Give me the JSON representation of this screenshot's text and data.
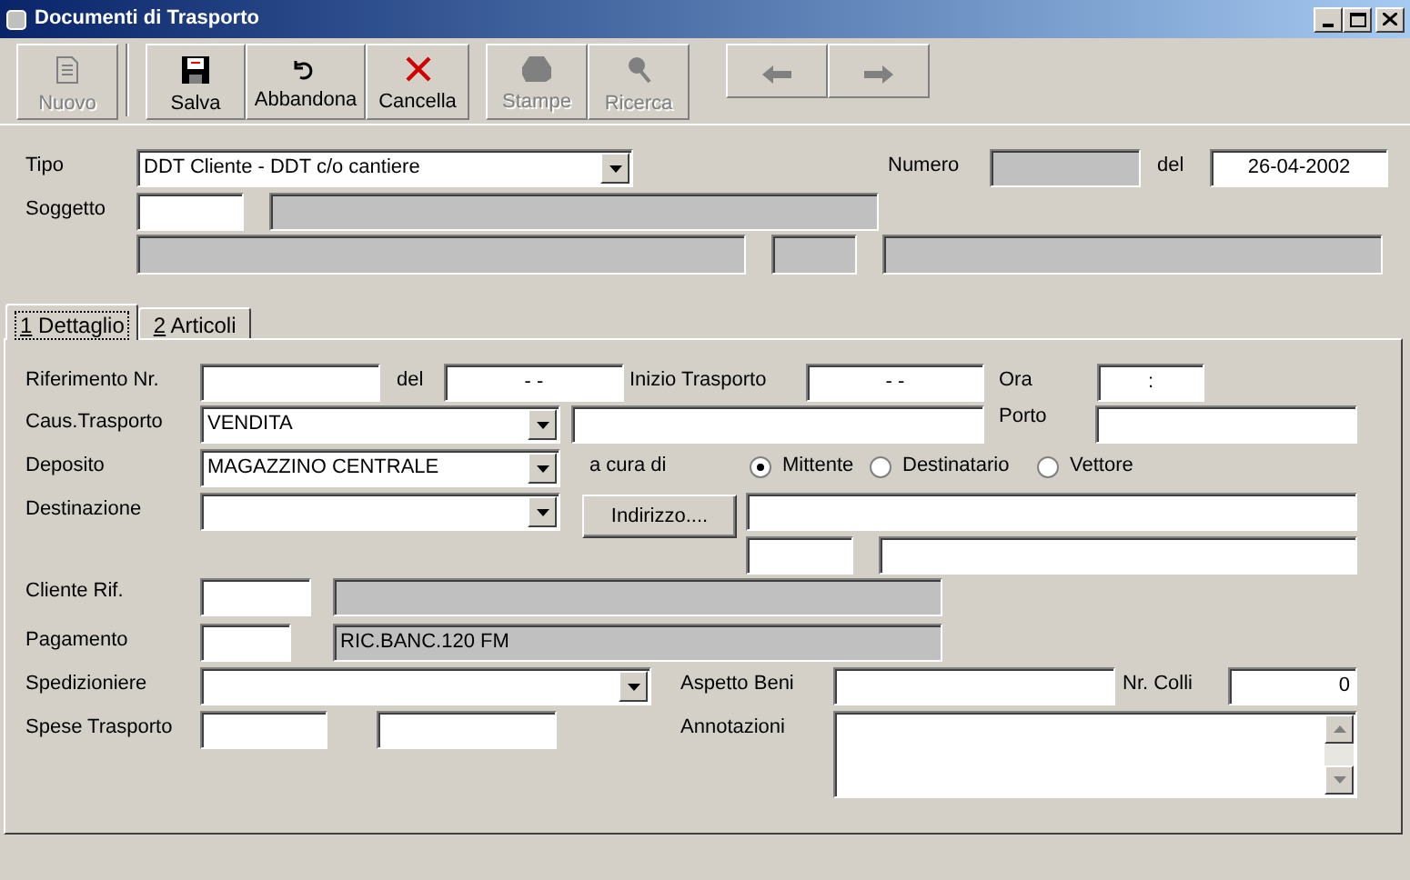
{
  "window": {
    "title": "Documenti di Trasporto"
  },
  "toolbar": [
    {
      "kind": "new",
      "label": "Nuovo",
      "disabled": true
    },
    {
      "kind": "save",
      "label": "Salva",
      "disabled": false
    },
    {
      "kind": "undo",
      "label": "Abbandona",
      "disabled": false
    },
    {
      "kind": "delete",
      "label": "Cancella",
      "disabled": false
    },
    {
      "kind": "print",
      "label": "Stampe",
      "disabled": true
    },
    {
      "kind": "search",
      "label": "Ricerca",
      "disabled": true
    },
    {
      "kind": "back",
      "disabled": true
    },
    {
      "kind": "forward",
      "disabled": true
    }
  ],
  "header": {
    "tipo": {
      "label": "Tipo",
      "value": "DDT Cliente - DDT c/o cantiere"
    },
    "numero": {
      "label": "Numero",
      "disabled": true
    },
    "data": {
      "label": "del",
      "value": "26-04-2002"
    },
    "soggetto": {
      "label": "Soggetto",
      "disabled": false
    },
    "soggetto_nome": {
      "disabled": true
    },
    "field_a": {
      "disabled": true
    },
    "field_b": {
      "disabled": true
    },
    "field_c": {
      "disabled": true
    }
  },
  "tabs": [
    {
      "mnemonic": "1",
      "label": "Dettaglio",
      "selected": true
    },
    {
      "mnemonic": "2",
      "label": "Articoli",
      "selected": false
    }
  ],
  "dettaglio": {
    "riferimento": {
      "label": "Riferimento Nr."
    },
    "riferimento_data": {
      "label": "del",
      "value": "-  -"
    },
    "inizio_trasporto": {
      "label": "Inizio Trasporto",
      "value": "-  -"
    },
    "ora": {
      "label": "Ora",
      "value": ":"
    },
    "causale": {
      "label": "Caus.Trasporto",
      "value": "VENDITA"
    },
    "porto": {
      "label": "Porto"
    },
    "deposito": {
      "label": "Deposito",
      "value": "MAGAZZINO CENTRALE"
    },
    "a_cura_di": {
      "label": "a cura di",
      "options": [
        {
          "label": "Mittente",
          "selected": true
        },
        {
          "label": "Destinatario",
          "selected": false
        },
        {
          "label": "Vettore",
          "selected": false
        }
      ]
    },
    "destinazione": {
      "label": "Destinazione"
    },
    "indirizzo_button": "Indirizzo....",
    "cliente_rif": {
      "label": "Cliente Rif.",
      "disabled": false
    },
    "cliente_rif_nome": {
      "disabled": true
    },
    "pagamento": {
      "label": "Pagamento",
      "disabled": false
    },
    "pagamento_descr": {
      "value": "RIC.BANC.120 FM",
      "disabled": true
    },
    "spedizioniere": {
      "label": "Spedizioniere"
    },
    "aspetto_beni": {
      "label": "Aspetto Beni"
    },
    "nr_colli": {
      "label": "Nr. Colli",
      "value": "0"
    },
    "spese_trasporto": {
      "label": "Spese Trasporto"
    },
    "annotazioni": {
      "label": "Annotazioni"
    }
  }
}
